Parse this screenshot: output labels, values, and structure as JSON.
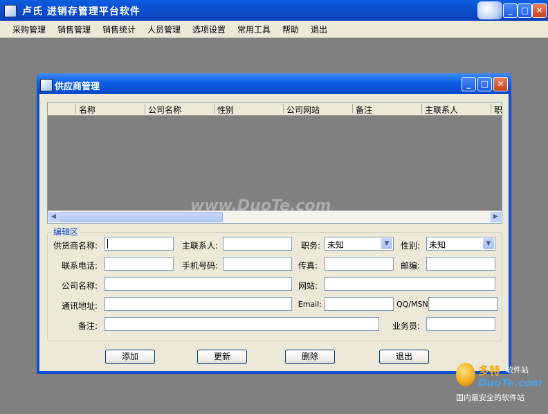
{
  "app": {
    "title": "卢氏 进销存管理平台软件"
  },
  "window_controls": {
    "minimize": "_",
    "maximize": "□",
    "close": "✕"
  },
  "menu": [
    "采购管理",
    "销售管理",
    "销售统计",
    "人员管理",
    "选项设置",
    "常用工具",
    "帮助",
    "退出"
  ],
  "dialog": {
    "title": "供应商管理"
  },
  "grid": {
    "columns": [
      "名称",
      "公司名称",
      "性别",
      "公司网站",
      "备注",
      "主联系人",
      "职"
    ]
  },
  "edit_group": {
    "legend": "编辑区"
  },
  "form": {
    "supplier_name_label": "供货商名称:",
    "main_contact_label": "主联系人:",
    "position_label": "职务:",
    "position_value": "未知",
    "gender_label": "性别:",
    "gender_value": "未知",
    "phone_label": "联系电话:",
    "mobile_label": "手机号码:",
    "fax_label": "传真:",
    "postcode_label": "邮编:",
    "company_label": "公司名称:",
    "website_label": "网站:",
    "address_label": "通讯地址:",
    "email_label": "Email:",
    "qq_label": "QQ/MSN:",
    "remark_label": "备注:",
    "salesman_label": "业务员:"
  },
  "buttons": {
    "add": "添加",
    "update": "更新",
    "delete": "删除",
    "exit": "退出"
  },
  "watermark": "www.DuoTe.com",
  "brand": {
    "name": "多特",
    "sub": "软件站",
    "domain": "DuoTe.com",
    "slogan": "国内最安全的软件站"
  }
}
